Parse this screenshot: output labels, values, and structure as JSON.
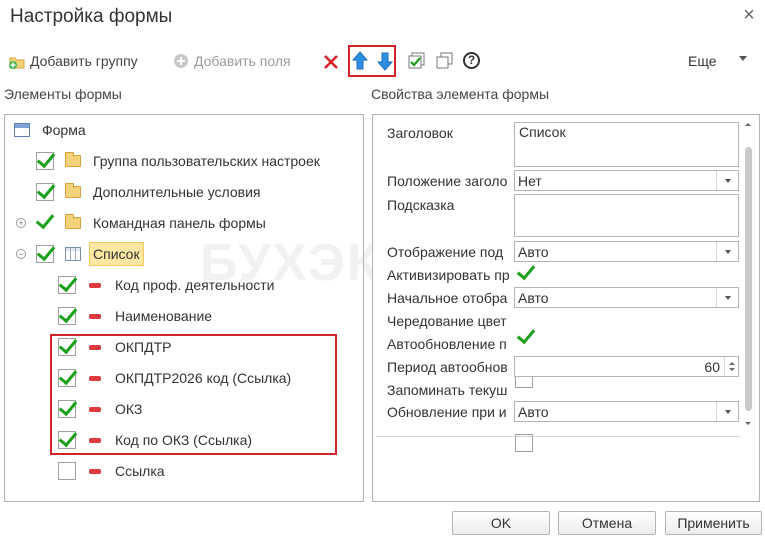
{
  "window": {
    "title": "Настройка формы",
    "close_glyph": "×"
  },
  "toolbar": {
    "add_group_label": "Добавить группу",
    "add_fields_label": "Добавить поля",
    "more_label": "Еще",
    "icons": [
      "add-group-icon",
      "add-fields-icon",
      "delete-icon",
      "move-up-icon",
      "move-down-icon",
      "check-all-icon",
      "copy-icon",
      "help-icon"
    ],
    "help_glyph": "?"
  },
  "left_panel": {
    "label": "Элементы формы",
    "tree": [
      {
        "label": "Форма",
        "icon": "form-icon",
        "checked": null
      },
      {
        "label": "Группа пользовательских настроек",
        "icon": "folder-icon",
        "checked": true
      },
      {
        "label": "Дополнительные условия",
        "icon": "folder-icon",
        "checked": true
      },
      {
        "label": "Командная панель формы",
        "icon": "folder-icon",
        "checked": true,
        "expander": "+"
      },
      {
        "label": "Список",
        "icon": "table-icon",
        "checked": true,
        "expander": "−",
        "selected": true
      },
      {
        "label": "Код проф. деятельности",
        "icon": "field-icon",
        "checked": true
      },
      {
        "label": "Наименование",
        "icon": "field-icon",
        "checked": true
      },
      {
        "label": "ОКПДТР",
        "icon": "field-icon",
        "checked": true
      },
      {
        "label": "ОКПДТР2026 код (Ссылка)",
        "icon": "field-icon",
        "checked": true
      },
      {
        "label": "ОКЗ",
        "icon": "field-icon",
        "checked": true
      },
      {
        "label": "Код по ОКЗ (Ссылка)",
        "icon": "field-icon",
        "checked": true
      },
      {
        "label": "Ссылка",
        "icon": "field-icon",
        "checked": false
      }
    ],
    "expander_plus": "+",
    "expander_minus": "−"
  },
  "right_panel": {
    "label": "Свойства элемента формы",
    "props": {
      "title_label": "Заголовок",
      "title_value": "Список",
      "title_position_label": "Положение заголо",
      "title_position_value": "Нет",
      "hint_label": "Подсказка",
      "hint_value": "",
      "display_label": "Отображение под",
      "display_value": "Авто",
      "activate_label": "Активизировать пр",
      "activate_checked": true,
      "initial_display_label": "Начальное отобра",
      "initial_display_value": "Авто",
      "alternate_label": "Чередование цвет",
      "alternate_checked": true,
      "autoupdate_label": "Автообновление п",
      "autoupdate_checked": false,
      "period_label": "Период автообнов",
      "period_value": "60",
      "remember_label": "Запоминать текуш",
      "remember_checked": false,
      "update_on_label": "Обновление при и",
      "update_on_value": "Авто"
    }
  },
  "watermark": "БУХЭКСПЕРТ",
  "footer": {
    "ok_label": "OK",
    "cancel_label": "Отмена",
    "apply_label": "Применить"
  },
  "colors": {
    "accent_red": "#d1232a",
    "check_green": "#1aa01a",
    "selection": "#fde7a3"
  }
}
